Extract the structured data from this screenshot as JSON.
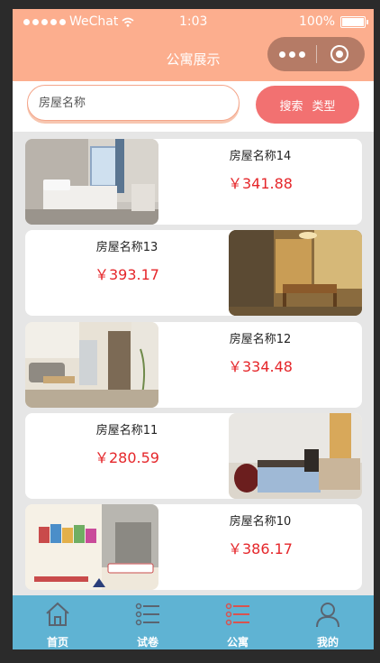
{
  "status": {
    "carrier": "WeChat",
    "time": "1:03",
    "battery": "100%"
  },
  "nav": {
    "title": "公寓展示"
  },
  "search": {
    "placeholder": "房屋名称",
    "button_search": "搜索",
    "button_type": "类型"
  },
  "listings": [
    {
      "name": "房屋名称14",
      "price": "￥341.88",
      "photo": "bedroom-photo"
    },
    {
      "name": "房屋名称13",
      "price": "￥393.17",
      "photo": "dining-room-photo"
    },
    {
      "name": "房屋名称12",
      "price": "￥334.48",
      "photo": "living-room-photo"
    },
    {
      "name": "房屋名称11",
      "price": "￥280.59",
      "photo": "bedroom-desk-photo"
    },
    {
      "name": "房屋名称10",
      "price": "￥386.17",
      "photo": "rental-home-poster"
    }
  ],
  "tabs": [
    {
      "label": "首页",
      "icon": "home-icon"
    },
    {
      "label": "试卷",
      "icon": "list-icon"
    },
    {
      "label": "公寓",
      "icon": "list-icon",
      "active": true
    },
    {
      "label": "我的",
      "icon": "user-icon"
    }
  ],
  "colors": {
    "header": "#fcae8e",
    "button": "#f27171",
    "price": "#e5262a",
    "tabbar": "#5fb3d3",
    "active_tab_icon": "#d9534f"
  }
}
